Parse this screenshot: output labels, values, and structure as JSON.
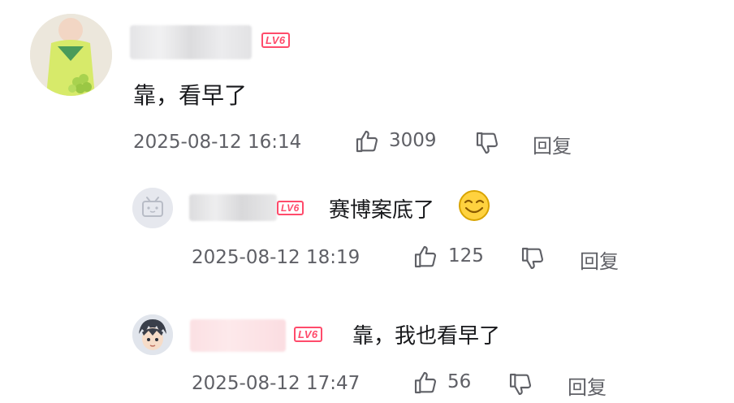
{
  "comments": [
    {
      "level_badge": "LV6",
      "text": "靠，看早了",
      "time": "2025-08-12 16:14",
      "likes": "3009",
      "reply_label": "回复"
    }
  ],
  "replies": [
    {
      "level_badge": "LV6",
      "text": "赛博案底了",
      "emoji": "smile-emoji",
      "time": "2025-08-12 18:19",
      "likes": "125",
      "reply_label": "回复"
    },
    {
      "level_badge": "LV6",
      "text": "靠，我也看早了",
      "time": "2025-08-12 17:47",
      "likes": "56",
      "reply_label": "回复"
    }
  ],
  "colors": {
    "level_badge": "#ff4b6b",
    "meta_text": "#5f6066",
    "content_text": "#18191c"
  }
}
